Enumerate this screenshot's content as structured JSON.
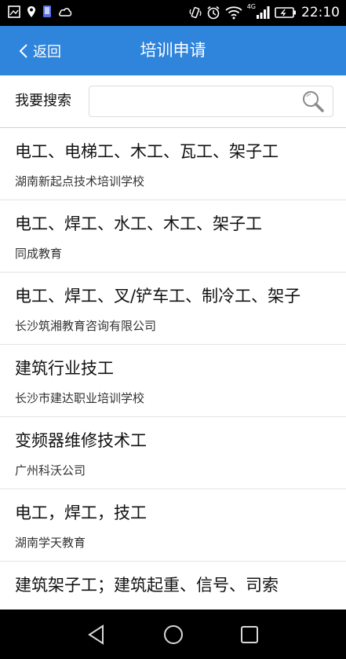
{
  "status_bar": {
    "time": "22:10",
    "network": "4G",
    "icons_left": [
      "gallery-icon",
      "location-icon",
      "phone-icon",
      "cloud-icon"
    ],
    "icons_right": [
      "vibrate-icon",
      "alarm-icon",
      "wifi-icon",
      "signal-icon",
      "battery-icon"
    ]
  },
  "nav": {
    "back_label": "返回",
    "title": "培训申请"
  },
  "search": {
    "label": "我要搜索",
    "value": "",
    "placeholder": ""
  },
  "items": [
    {
      "title": "电工、电梯工、木工、瓦工、架子工",
      "org": "湖南新起点技术培训学校"
    },
    {
      "title": "电工、焊工、水工、木工、架子工",
      "org": "同成教育"
    },
    {
      "title": "电工、焊工、叉/铲车工、制冷工、架子",
      "org": "长沙筑湘教育咨询有限公司"
    },
    {
      "title": "建筑行业技工",
      "org": "长沙市建达职业培训学校"
    },
    {
      "title": "变频器维修技术工",
      "org": "广州科沃公司"
    },
    {
      "title": "电工，焊工，技工",
      "org": "湖南学天教育"
    },
    {
      "title": "建筑架子工；建筑起重、信号、司索",
      "org": ""
    }
  ],
  "colors": {
    "accent": "#2f84dc",
    "status_bar": "#000000",
    "nav_keys": "#000000"
  }
}
